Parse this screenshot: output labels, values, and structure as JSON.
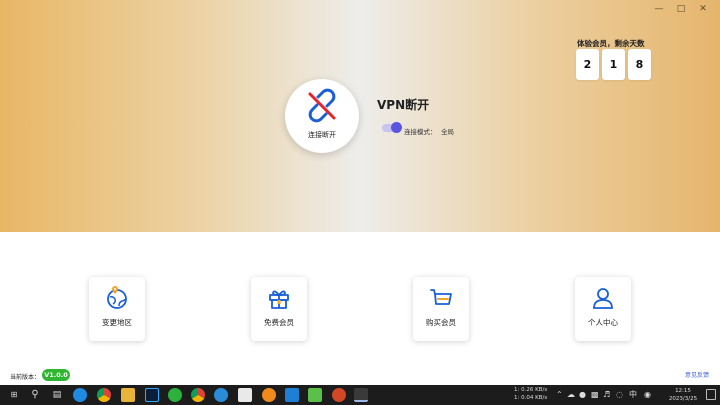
{
  "window": {
    "minimize_icon": "minimize-icon",
    "maximize_icon": "maximize-icon",
    "close_icon": "close-icon"
  },
  "connect": {
    "button_label": "连接断开",
    "icon": "broken-link-icon"
  },
  "status": {
    "title": "VPN断开",
    "mode_label": "连接模式：",
    "mode_value": "全局"
  },
  "membership": {
    "title": "体验会员，剩余天数",
    "days_digits": [
      "2",
      "1",
      "8"
    ]
  },
  "cards": [
    {
      "label": "变更地区",
      "icon": "globe-pin-icon"
    },
    {
      "label": "免费会员",
      "icon": "gift-icon"
    },
    {
      "label": "购买会员",
      "icon": "shopping-basket-icon"
    },
    {
      "label": "个人中心",
      "icon": "user-icon"
    }
  ],
  "footer": {
    "version_label": "当前版本：",
    "version": "V1.0.0",
    "feedback": "意见反馈"
  },
  "taskbar": {
    "net_up": "1: 0.26 KB/s",
    "net_down": "1: 0.04 KB/s",
    "ime": "中",
    "time": "12:15",
    "date": "2023/3/25"
  },
  "colors": {
    "accent": "#1a5fd6",
    "danger": "#e2232a",
    "toggle": "#5a55e0",
    "version_badge": "#2fb52f"
  }
}
